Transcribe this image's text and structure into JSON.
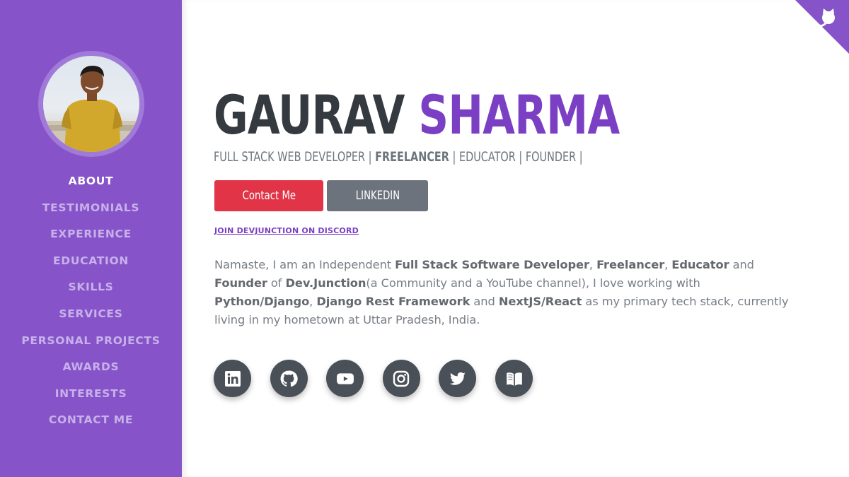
{
  "profile": {
    "first_name": "GAURAV",
    "last_name": "SHARMA",
    "roles": [
      "FULL STACK WEB DEVELOPER | ",
      "FREELANCER",
      " | EDUCATOR | FOUNDER |"
    ]
  },
  "nav": {
    "items": [
      "ABOUT",
      "TESTIMONIALS",
      "EXPERIENCE",
      "EDUCATION",
      "SKILLS",
      "SERVICES",
      "PERSONAL PROJECTS",
      "AWARDS",
      "INTERESTS",
      "CONTACT ME"
    ],
    "active": "ABOUT"
  },
  "buttons": {
    "contact": "Contact Me",
    "linkedin": "LINKEDIN"
  },
  "discord_link": "JOIN DEVJUNCTION ON DISCORD",
  "bio": [
    {
      "t": "Namaste, I am an Independent "
    },
    {
      "t": "Full Stack Software Developer",
      "b": true
    },
    {
      "t": ", "
    },
    {
      "t": "Freelancer",
      "b": true
    },
    {
      "t": ", "
    },
    {
      "t": "Educator",
      "b": true
    },
    {
      "t": " and "
    },
    {
      "t": "Founder",
      "b": true
    },
    {
      "t": " of "
    },
    {
      "t": "Dev.Junction",
      "b": true
    },
    {
      "t": "(a Community and a YouTube channel), I love working with "
    },
    {
      "t": "Python/Django",
      "b": true
    },
    {
      "t": ", "
    },
    {
      "t": "Django Rest Framework",
      "b": true
    },
    {
      "t": " and "
    },
    {
      "t": "NextJS/React",
      "b": true
    },
    {
      "t": " as my primary tech stack, currently living in my hometown at Uttar Pradesh, India."
    }
  ],
  "socials": [
    "linkedin-icon",
    "github-icon",
    "youtube-icon",
    "instagram-icon",
    "twitter-icon",
    "book-icon"
  ],
  "colors": {
    "sidebar": "#8753c9",
    "accent": "#7b3fc4",
    "contact_button": "#e13447",
    "linkedin_button": "#6c737c",
    "social_circle": "#495057"
  }
}
